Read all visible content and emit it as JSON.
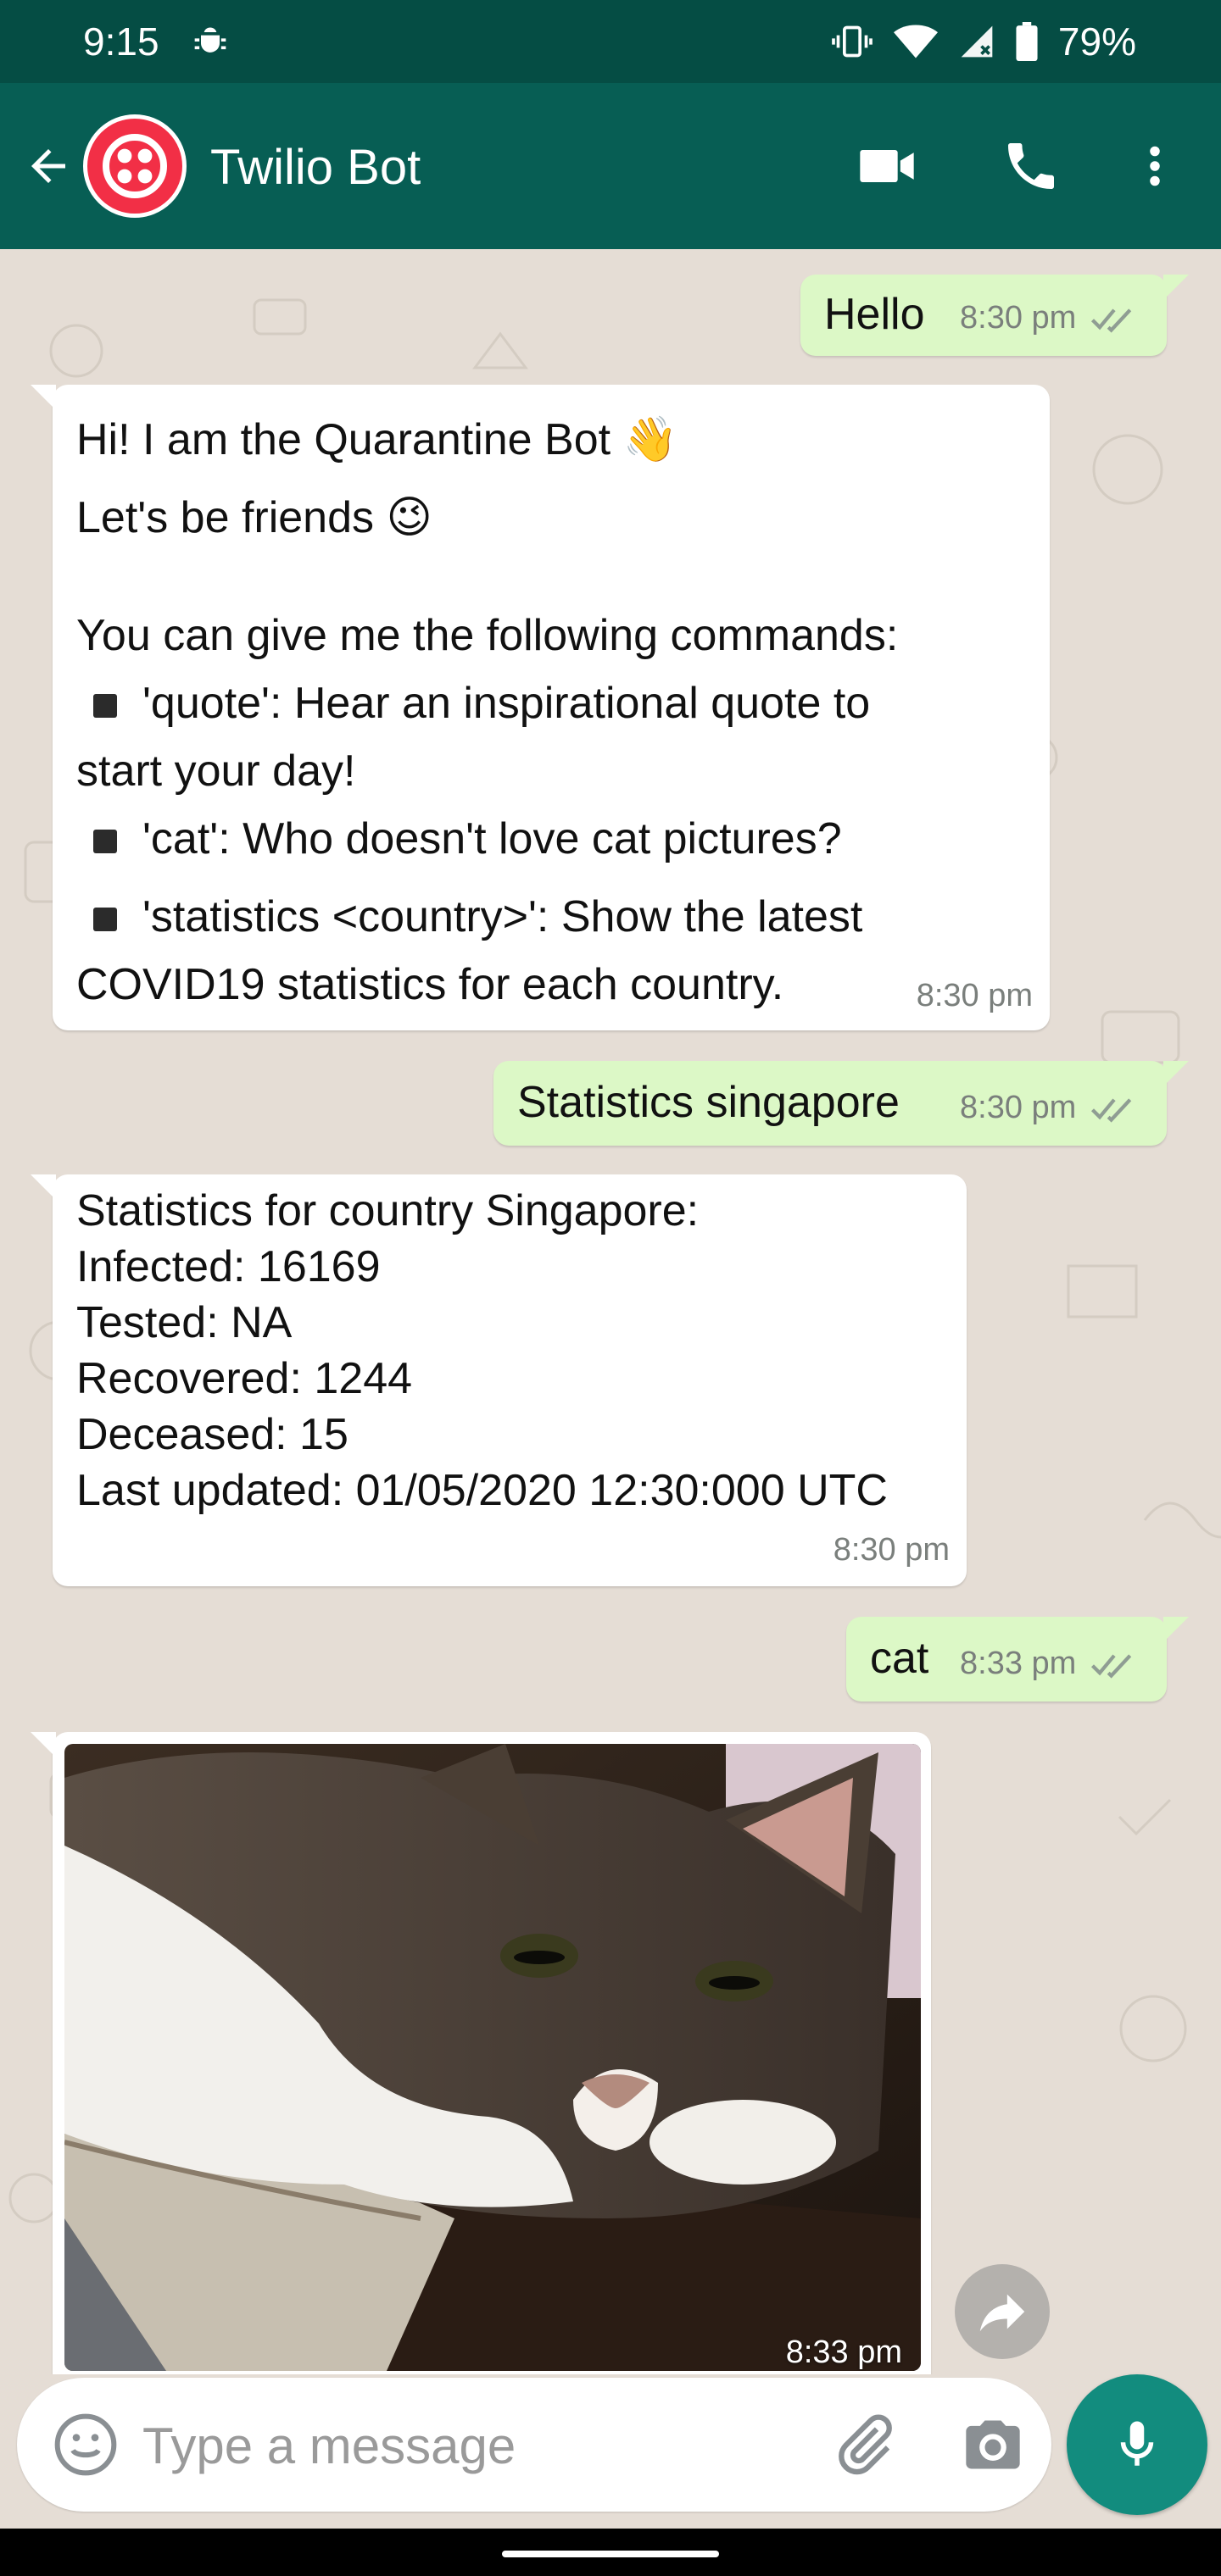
{
  "status_bar": {
    "time": "9:15",
    "battery": "79%",
    "icons": [
      "debug-icon",
      "vibrate-icon",
      "wifi-icon",
      "signal-icon",
      "battery-icon"
    ]
  },
  "header": {
    "contact_name": "Twilio Bot",
    "avatar": "twilio-logo",
    "icons": [
      "back-arrow-icon",
      "video-call-icon",
      "phone-icon",
      "more-vert-icon"
    ],
    "accent_color": "#075e54",
    "status_bar_color": "#054d44"
  },
  "messages": [
    {
      "direction": "out",
      "text": "Hello",
      "time": "8:30 pm"
    },
    {
      "direction": "in",
      "intro_line1": "Hi! I am the Quarantine Bot 👋",
      "intro_line2": "Let's be friends 😉",
      "commands_heading": "You can give me the following commands:",
      "cmd1_a": "'quote': Hear an inspirational quote to",
      "cmd1_b": "start your day!",
      "cmd2": "'cat': Who doesn't love cat pictures?",
      "cmd3_a": "'statistics <country>': Show the latest",
      "cmd3_b": "COVID19 statistics for each country.",
      "time": "8:30 pm"
    },
    {
      "direction": "out",
      "text": "Statistics singapore",
      "time": "8:30 pm"
    },
    {
      "direction": "in",
      "lines": [
        "Statistics for country Singapore:",
        "Infected: 16169",
        "Tested: NA",
        "Recovered: 1244",
        "Deceased: 15",
        "Last updated: 01/05/2020 12:30:000 UTC"
      ],
      "time": "8:30 pm"
    },
    {
      "direction": "out",
      "text": "cat",
      "time": "8:33 pm"
    },
    {
      "direction": "in",
      "type": "image",
      "image": "cat-photo",
      "time": "8:33 pm"
    }
  ],
  "composer": {
    "placeholder": "Type a message",
    "value": "",
    "icons": [
      "emoji-icon",
      "attach-icon",
      "camera-icon",
      "mic-icon"
    ]
  },
  "colors": {
    "outgoing_bubble": "#dcf8c6",
    "incoming_bubble": "#ffffff",
    "chat_background": "#e5ddd5",
    "mic_button": "#128c7e"
  }
}
